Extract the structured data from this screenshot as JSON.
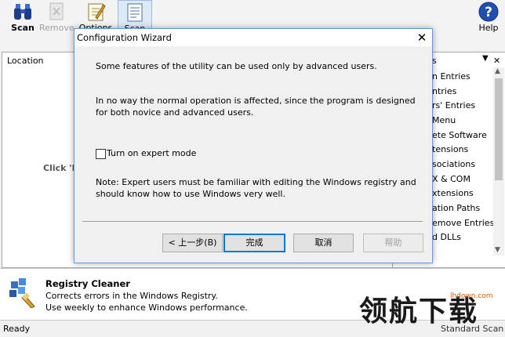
{
  "toolbar": {
    "scan": "Scan",
    "remove": "Remove",
    "options": "Options",
    "scan2": "Scan",
    "help": "Help"
  },
  "left_pane": {
    "location_header": "Location",
    "click_hint": "Click 'R"
  },
  "right_pane": {
    "header_tail": "s",
    "items": [
      "n Entries",
      "ntries",
      "rs' Entries",
      "Menu",
      "ete Software",
      "tensions",
      "sociations",
      "X & COM",
      "xtensions",
      "ation Paths",
      "emove Entries",
      "d DLLs"
    ]
  },
  "info": {
    "title": "Registry Cleaner",
    "line1": "Corrects errors in the Windows Registry.",
    "line2": "Use weekly to enhance Windows performance."
  },
  "status": {
    "ready": "Ready",
    "mode": "Standard Scan"
  },
  "dialog": {
    "title": "Configuration Wizard",
    "close": "✕",
    "p1": "Some features of the utility can be used only by advanced users.",
    "p2a": "In no way the normal operation is affected, since the program is designed",
    "p2b": "for both novice and advanced users.",
    "checkbox_label": "Turn on expert mode",
    "p3a": "Note: Expert users must be familiar with editing the Windows registry and",
    "p3b": "should know how to use Windows very well.",
    "btn_back": "< 上一步(B)",
    "btn_finish": "完成",
    "btn_cancel": "取消",
    "btn_help": "帮助"
  },
  "watermark": {
    "text": "领航下载",
    "url": "lhdown.com"
  }
}
